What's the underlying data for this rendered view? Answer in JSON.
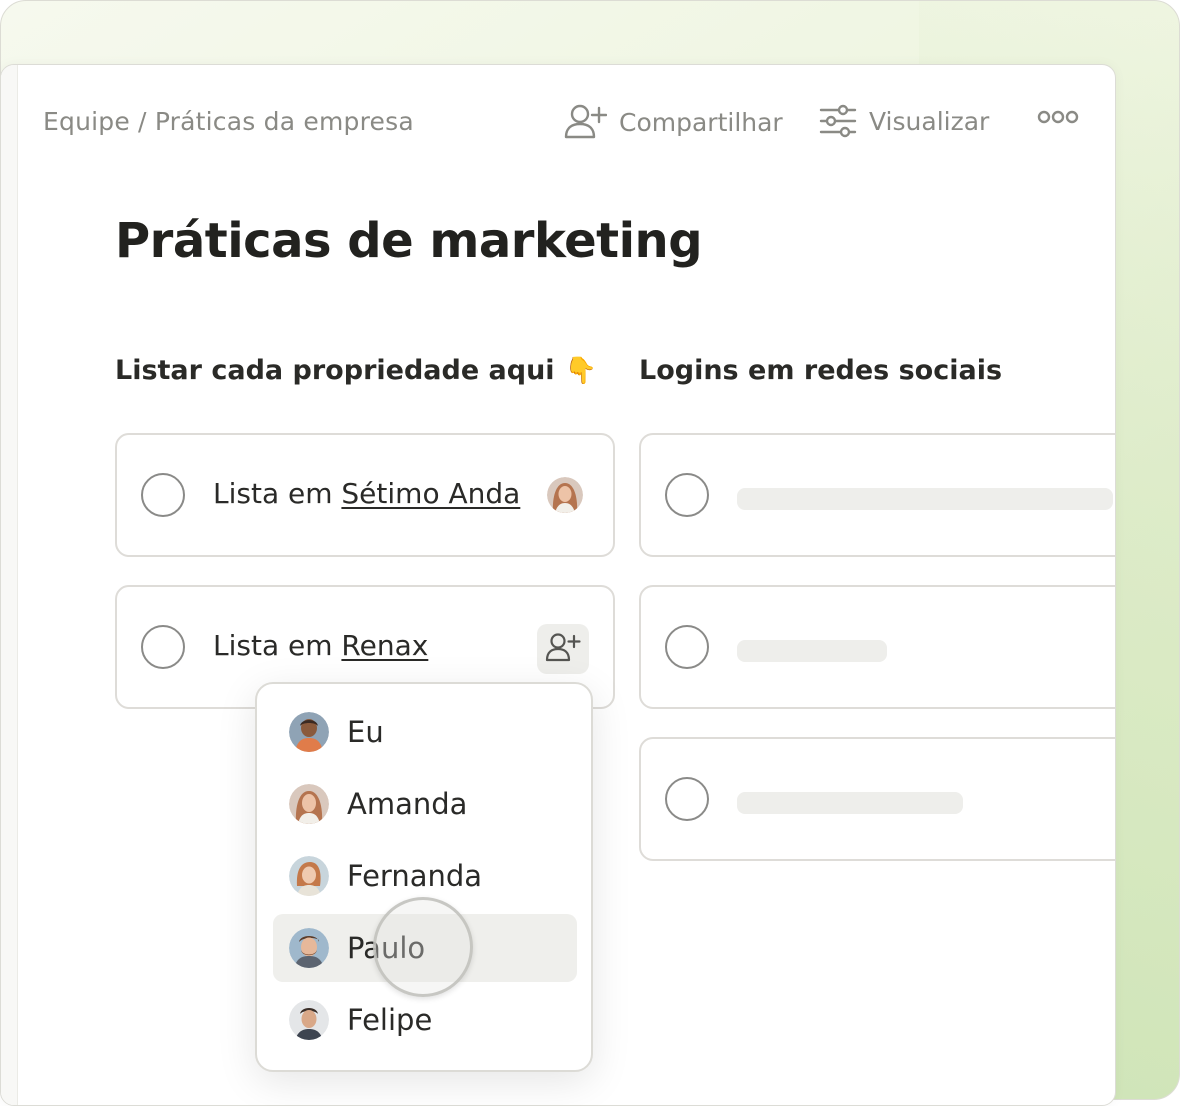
{
  "breadcrumb": "Equipe / Práticas da empresa",
  "toolbar": {
    "share_label": "Compartilhar",
    "view_label": "Visualizar",
    "share_icon": "add-user-icon",
    "view_icon": "sliders-icon",
    "more_icon": "more-dots-icon"
  },
  "page": {
    "title": "Práticas de marketing"
  },
  "columns": [
    {
      "heading": "Listar cada propriedade aqui",
      "heading_emoji": "👇",
      "cards": [
        {
          "prefix": "Lista em ",
          "link": "Sétimo Anda",
          "assignee_icon": "avatar-amanda"
        },
        {
          "prefix": "Lista em ",
          "link": "Renax",
          "action_icon": "add-user-icon"
        }
      ]
    },
    {
      "heading": "Logins em redes sociais",
      "cards": [
        {
          "placeholder": true
        },
        {
          "placeholder": true
        },
        {
          "placeholder": true
        }
      ]
    }
  ],
  "assign_menu": {
    "items": [
      {
        "name": "Eu",
        "selected": false
      },
      {
        "name": "Amanda",
        "selected": false
      },
      {
        "name": "Fernanda",
        "selected": false
      },
      {
        "name": "Paulo",
        "selected": true
      },
      {
        "name": "Felipe",
        "selected": false
      }
    ]
  },
  "colors": {
    "text_primary": "#22221f",
    "text_muted": "#8a8a85",
    "border": "#dedcd8",
    "skeleton": "#eeeeeb",
    "menu_highlight": "#efefec",
    "background_tint": "#e6f0d5"
  }
}
